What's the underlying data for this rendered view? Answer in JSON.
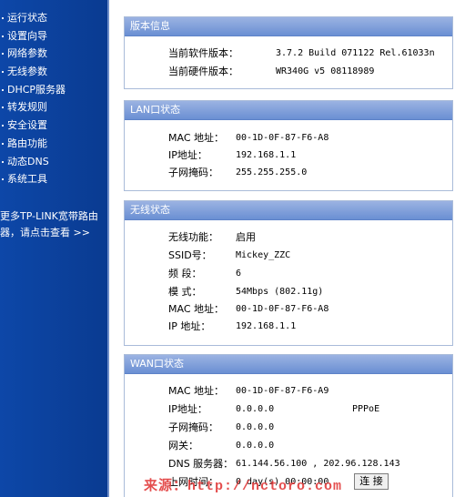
{
  "sidebar": {
    "items": [
      {
        "label": "运行状态"
      },
      {
        "label": "设置向导"
      },
      {
        "label": "网络参数"
      },
      {
        "label": "无线参数"
      },
      {
        "label": "DHCP服务器"
      },
      {
        "label": "转发规则"
      },
      {
        "label": "安全设置"
      },
      {
        "label": "路由功能"
      },
      {
        "label": "动态DNS"
      },
      {
        "label": "系统工具"
      }
    ],
    "promo_line1": "更多TP-LINK宽带路由",
    "promo_line2": "器，请点击查看 >>"
  },
  "version": {
    "title": "版本信息",
    "software_label": "当前软件版本：",
    "software_value": "3.7.2 Build 071122 Rel.61033n",
    "hardware_label": "当前硬件版本：",
    "hardware_value": "WR340G v5 08118989"
  },
  "lan": {
    "title": "LAN口状态",
    "mac_label": "MAC 地址：",
    "mac_value": "00-1D-0F-87-F6-A8",
    "ip_label": "IP地址：",
    "ip_value": "192.168.1.1",
    "mask_label": "子网掩码：",
    "mask_value": "255.255.255.0"
  },
  "wireless": {
    "title": "无线状态",
    "func_label": "无线功能：",
    "func_value": "启用",
    "ssid_label": "SSID号：",
    "ssid_value": "Mickey_ZZC",
    "channel_label": "频 段：",
    "channel_value": "6",
    "mode_label": "模 式：",
    "mode_value": "54Mbps (802.11g)",
    "mac_label": "MAC 地址：",
    "mac_value": "00-1D-0F-87-F6-A8",
    "ip_label": "IP 地址：",
    "ip_value": "192.168.1.1"
  },
  "wan": {
    "title": "WAN口状态",
    "mac_label": "MAC 地址：",
    "mac_value": "00-1D-0F-87-F6-A9",
    "ip_label": "IP地址：",
    "ip_value": "0.0.0.0",
    "conn_type": "PPPoE",
    "mask_label": "子网掩码：",
    "mask_value": "0.0.0.0",
    "gw_label": "网关：",
    "gw_value": "0.0.0.0",
    "dns_label": "DNS 服务器：",
    "dns_value": "61.144.56.100 , 202.96.128.143",
    "time_label": "上网时间：",
    "time_value": "0 day(s) 00:00:00",
    "connect_button": "连 接"
  },
  "watermark": "来源：http://nctoro.com"
}
